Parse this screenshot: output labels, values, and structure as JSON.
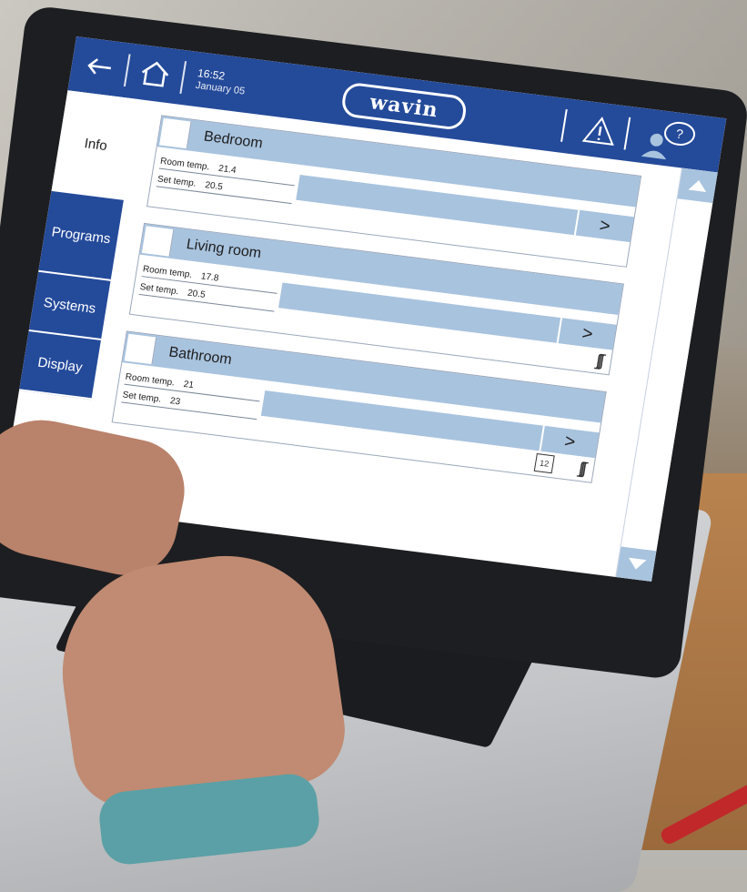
{
  "topbar": {
    "time": "16:52",
    "date": "January 05",
    "logo": "wavin"
  },
  "sidebar": {
    "items": [
      {
        "label": "Info",
        "active": true
      },
      {
        "label": "Programs",
        "active": false
      },
      {
        "label": "Systems",
        "active": false
      },
      {
        "label": "Display",
        "active": false
      }
    ]
  },
  "rooms": [
    {
      "name": "Bedroom",
      "room_temp_label": "Room temp.",
      "room_temp": "21.4",
      "set_temp_label": "Set temp.",
      "set_temp": "20.5",
      "heating": false,
      "schedule": null
    },
    {
      "name": "Living room",
      "room_temp_label": "Room temp.",
      "room_temp": "17.8",
      "set_temp_label": "Set temp.",
      "set_temp": "20.5",
      "heating": true,
      "schedule": null
    },
    {
      "name": "Bathroom",
      "room_temp_label": "Room temp.",
      "room_temp": "21",
      "set_temp_label": "Set temp.",
      "set_temp": "23",
      "heating": true,
      "schedule": "12"
    }
  ],
  "colors": {
    "brand_blue": "#244a9a",
    "accent_light_blue": "#a8c3de"
  }
}
